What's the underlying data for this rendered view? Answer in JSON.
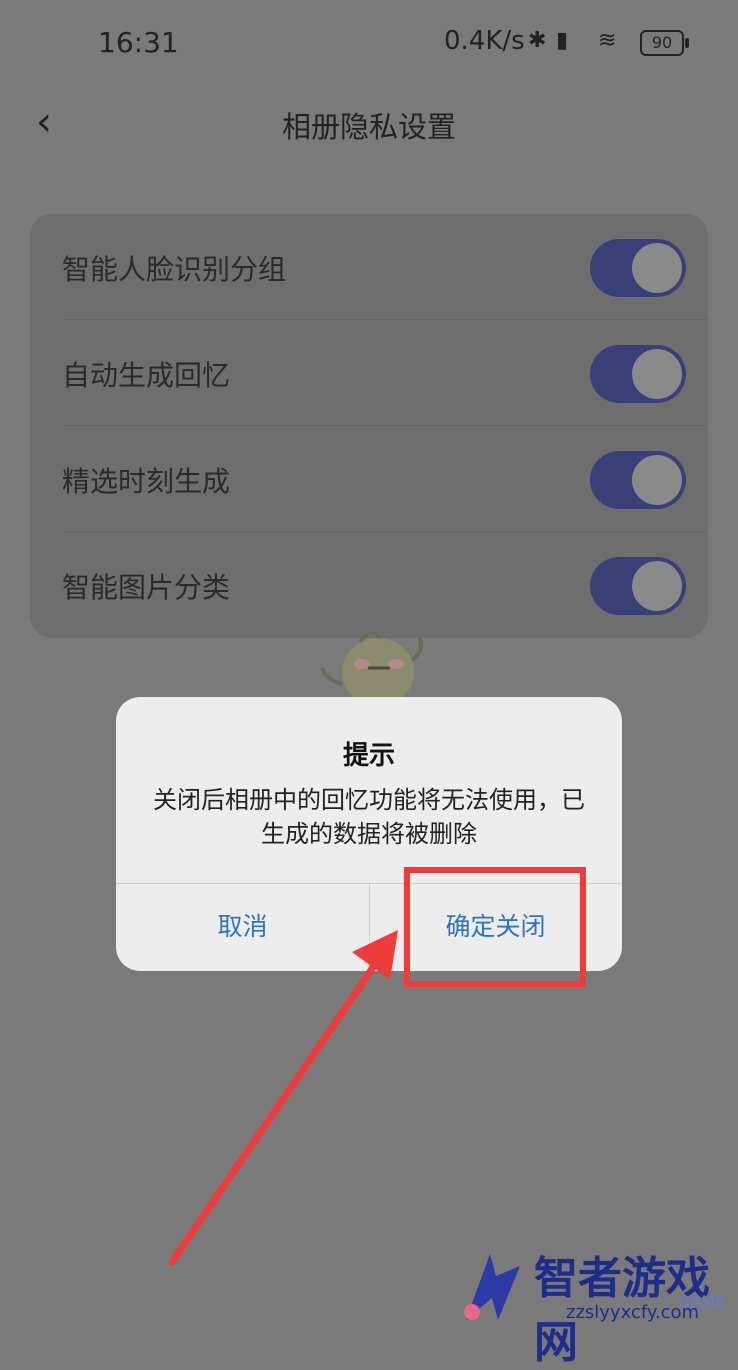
{
  "status_bar": {
    "time": "16:31",
    "network_speed": "0.4K/s",
    "battery": "90"
  },
  "header": {
    "back_icon": "chevron-left-icon",
    "title": "相册隐私设置"
  },
  "settings": {
    "items": [
      {
        "label": "智能人脸识别分组",
        "enabled": true
      },
      {
        "label": "自动生成回忆",
        "enabled": true
      },
      {
        "label": "精选时刻生成",
        "enabled": true
      },
      {
        "label": "智能图片分类",
        "enabled": true
      }
    ]
  },
  "dialog": {
    "title": "提示",
    "message": "关闭后相册中的回忆功能将无法使用，已生成的数据将被删除",
    "cancel_label": "取消",
    "confirm_label": "确定关闭"
  },
  "watermark": {
    "title": "智者游戏网",
    "url": "zzslyyxcfy.com",
    "tag": "GAME"
  },
  "colors": {
    "accent": "#2f73c8",
    "toggle_on": "#3b3f78",
    "annotation": "#ee3b3b"
  }
}
